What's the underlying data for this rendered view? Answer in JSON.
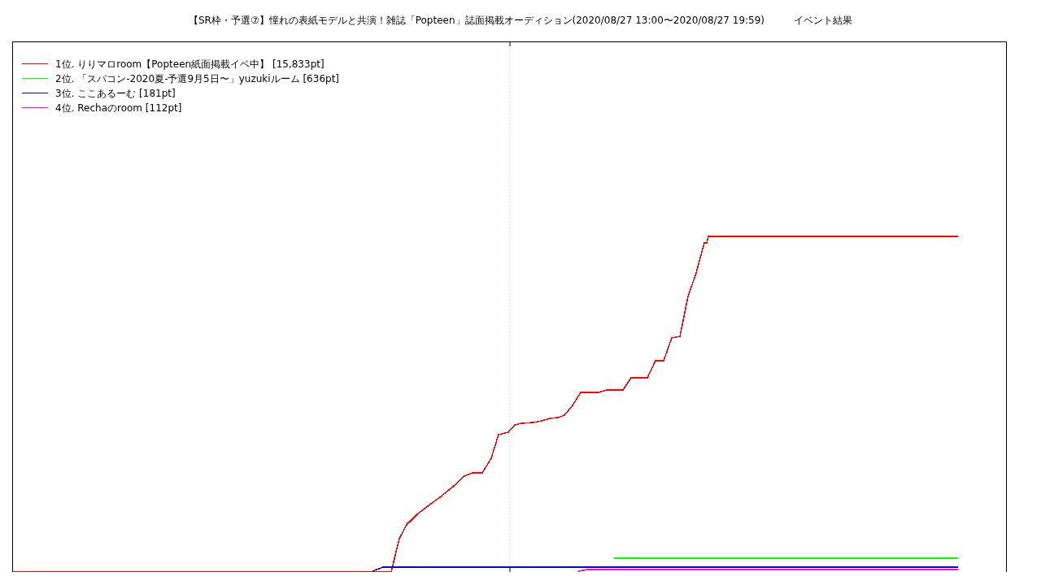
{
  "title": "【SR枠・予選⑦】憧れの表紙モデルと共演！雑誌「Popteen」誌面掲載オーディション(2020/08/27 13:00〜2020/08/27 19:59)",
  "subtitle": "イベント結果",
  "legend": [
    {
      "label": "1位. りりマロroom【Popteen紙面掲載イベ中】 [15,833pt]",
      "color": "#ff0000"
    },
    {
      "label": "2位. 「スパコン-2020夏-予選9月5日〜」yuzukiルーム [636pt]",
      "color": "#00ff00"
    },
    {
      "label": "3位. ここあるーむ [181pt]",
      "color": "#0000ff"
    },
    {
      "label": "4位. Rechaのroom [112pt]",
      "color": "#ff00ff"
    }
  ]
}
